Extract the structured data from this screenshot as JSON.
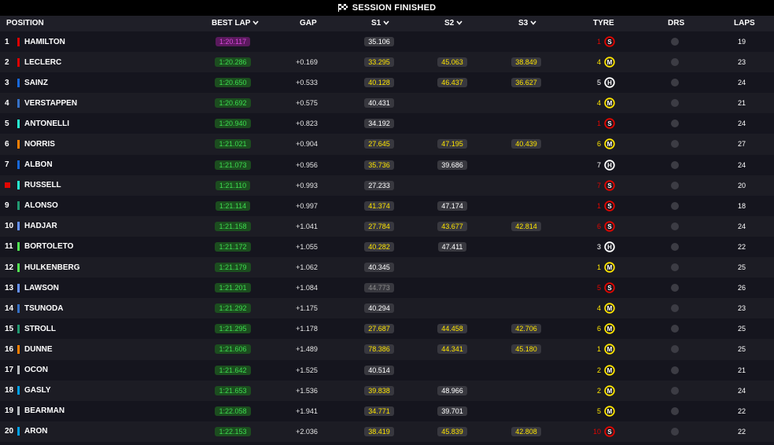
{
  "banner": {
    "title": "SESSION FINISHED"
  },
  "header": {
    "position": "POSITION",
    "best_lap": "BEST LAP",
    "gap": "GAP",
    "s1": "S1",
    "s2": "S2",
    "s3": "S3",
    "tyre": "TYRE",
    "drs": "DRS",
    "laps": "LAPS"
  },
  "colors": {
    "purple_time": "#d646d9",
    "green_time": "#3ddc4f",
    "yellow_sector": "#fce300",
    "soft": "#e10600",
    "medium": "#fce300",
    "hard": "#ffffff"
  },
  "rows": [
    {
      "pos": "1",
      "driver": "HAMILTON",
      "team_color": "#dc0000",
      "best": "1:20.117",
      "best_purple": true,
      "gap": "",
      "s1": "35.106",
      "s1c": "w",
      "s2": "",
      "s2c": "",
      "s3": "",
      "s3c": "",
      "tyre_age": "1",
      "tyre": "S",
      "laps": "19"
    },
    {
      "pos": "2",
      "driver": "LECLERC",
      "team_color": "#dc0000",
      "best": "1:20.286",
      "best_purple": false,
      "gap": "+0.169",
      "s1": "33.295",
      "s1c": "y",
      "s2": "45.063",
      "s2c": "y",
      "s3": "38.849",
      "s3c": "y",
      "tyre_age": "4",
      "tyre": "M",
      "laps": "23"
    },
    {
      "pos": "3",
      "driver": "SAINZ",
      "team_color": "#1868db",
      "best": "1:20.650",
      "best_purple": false,
      "gap": "+0.533",
      "s1": "40.128",
      "s1c": "y",
      "s2": "46.437",
      "s2c": "y",
      "s3": "36.627",
      "s3c": "y",
      "tyre_age": "5",
      "tyre": "H",
      "laps": "24"
    },
    {
      "pos": "4",
      "driver": "VERSTAPPEN",
      "team_color": "#3671c6",
      "best": "1:20.692",
      "best_purple": false,
      "gap": "+0.575",
      "s1": "40.431",
      "s1c": "w",
      "s2": "",
      "s2c": "",
      "s3": "",
      "s3c": "",
      "tyre_age": "4",
      "tyre": "M",
      "laps": "21"
    },
    {
      "pos": "5",
      "driver": "ANTONELLI",
      "team_color": "#27f4d2",
      "best": "1:20.940",
      "best_purple": false,
      "gap": "+0.823",
      "s1": "34.192",
      "s1c": "w",
      "s2": "",
      "s2c": "",
      "s3": "",
      "s3c": "",
      "tyre_age": "1",
      "tyre": "S",
      "laps": "24"
    },
    {
      "pos": "6",
      "driver": "NORRIS",
      "team_color": "#ff8000",
      "best": "1:21.021",
      "best_purple": false,
      "gap": "+0.904",
      "s1": "27.645",
      "s1c": "y",
      "s2": "47.195",
      "s2c": "y",
      "s3": "40.439",
      "s3c": "y",
      "tyre_age": "6",
      "tyre": "M",
      "laps": "27"
    },
    {
      "pos": "7",
      "driver": "ALBON",
      "team_color": "#1868db",
      "best": "1:21.073",
      "best_purple": false,
      "gap": "+0.956",
      "s1": "35.736",
      "s1c": "y",
      "s2": "39.686",
      "s2c": "w",
      "s3": "",
      "s3c": "",
      "tyre_age": "7",
      "tyre": "H",
      "laps": "24"
    },
    {
      "pos": "FLAG",
      "driver": "RUSSELL",
      "team_color": "#27f4d2",
      "best": "1:21.110",
      "best_purple": false,
      "gap": "+0.993",
      "s1": "27.233",
      "s1c": "w",
      "s2": "",
      "s2c": "",
      "s3": "",
      "s3c": "",
      "tyre_age": "7",
      "tyre": "S",
      "laps": "20"
    },
    {
      "pos": "9",
      "driver": "ALONSO",
      "team_color": "#229971",
      "best": "1:21.114",
      "best_purple": false,
      "gap": "+0.997",
      "s1": "41.374",
      "s1c": "y",
      "s2": "47.174",
      "s2c": "w",
      "s3": "",
      "s3c": "",
      "tyre_age": "1",
      "tyre": "S",
      "laps": "18"
    },
    {
      "pos": "10",
      "driver": "HADJAR",
      "team_color": "#6692ff",
      "best": "1:21.158",
      "best_purple": false,
      "gap": "+1.041",
      "s1": "27.784",
      "s1c": "y",
      "s2": "43.677",
      "s2c": "y",
      "s3": "42.814",
      "s3c": "y",
      "tyre_age": "6",
      "tyre": "S",
      "laps": "24"
    },
    {
      "pos": "11",
      "driver": "BORTOLETO",
      "team_color": "#52e252",
      "best": "1:21.172",
      "best_purple": false,
      "gap": "+1.055",
      "s1": "40.282",
      "s1c": "y",
      "s2": "47.411",
      "s2c": "w",
      "s3": "",
      "s3c": "",
      "tyre_age": "3",
      "tyre": "H",
      "laps": "22"
    },
    {
      "pos": "12",
      "driver": "HULKENBERG",
      "team_color": "#52e252",
      "best": "1:21.179",
      "best_purple": false,
      "gap": "+1.062",
      "s1": "40.345",
      "s1c": "w",
      "s2": "",
      "s2c": "",
      "s3": "",
      "s3c": "",
      "tyre_age": "1",
      "tyre": "M",
      "laps": "25"
    },
    {
      "pos": "13",
      "driver": "LAWSON",
      "team_color": "#6692ff",
      "best": "1:21.201",
      "best_purple": false,
      "gap": "+1.084",
      "s1": "44.773",
      "s1c": "g",
      "s2": "",
      "s2c": "",
      "s3": "",
      "s3c": "",
      "tyre_age": "5",
      "tyre": "S",
      "laps": "26"
    },
    {
      "pos": "14",
      "driver": "TSUNODA",
      "team_color": "#3671c6",
      "best": "1:21.292",
      "best_purple": false,
      "gap": "+1.175",
      "s1": "40.294",
      "s1c": "w",
      "s2": "",
      "s2c": "",
      "s3": "",
      "s3c": "",
      "tyre_age": "4",
      "tyre": "M",
      "laps": "23"
    },
    {
      "pos": "15",
      "driver": "STROLL",
      "team_color": "#229971",
      "best": "1:21.295",
      "best_purple": false,
      "gap": "+1.178",
      "s1": "27.687",
      "s1c": "y",
      "s2": "44.458",
      "s2c": "y",
      "s3": "42.706",
      "s3c": "y",
      "tyre_age": "6",
      "tyre": "M",
      "laps": "25"
    },
    {
      "pos": "16",
      "driver": "DUNNE",
      "team_color": "#ff8000",
      "best": "1:21.606",
      "best_purple": false,
      "gap": "+1.489",
      "s1": "78.386",
      "s1c": "y",
      "s2": "44.341",
      "s2c": "y",
      "s3": "45.180",
      "s3c": "y",
      "tyre_age": "1",
      "tyre": "M",
      "laps": "25"
    },
    {
      "pos": "17",
      "driver": "OCON",
      "team_color": "#b6babd",
      "best": "1:21.642",
      "best_purple": false,
      "gap": "+1.525",
      "s1": "40.514",
      "s1c": "w",
      "s2": "",
      "s2c": "",
      "s3": "",
      "s3c": "",
      "tyre_age": "2",
      "tyre": "M",
      "laps": "21"
    },
    {
      "pos": "18",
      "driver": "GASLY",
      "team_color": "#00a1e8",
      "best": "1:21.653",
      "best_purple": false,
      "gap": "+1.536",
      "s1": "39.838",
      "s1c": "y",
      "s2": "48.966",
      "s2c": "w",
      "s3": "",
      "s3c": "",
      "tyre_age": "2",
      "tyre": "M",
      "laps": "24"
    },
    {
      "pos": "19",
      "driver": "BEARMAN",
      "team_color": "#b6babd",
      "best": "1:22.058",
      "best_purple": false,
      "gap": "+1.941",
      "s1": "34.771",
      "s1c": "y",
      "s2": "39.701",
      "s2c": "w",
      "s3": "",
      "s3c": "",
      "tyre_age": "5",
      "tyre": "M",
      "laps": "22"
    },
    {
      "pos": "20",
      "driver": "ARON",
      "team_color": "#00a1e8",
      "best": "1:22.153",
      "best_purple": false,
      "gap": "+2.036",
      "s1": "38.419",
      "s1c": "y",
      "s2": "45.839",
      "s2c": "y",
      "s3": "42.808",
      "s3c": "y",
      "tyre_age": "10",
      "tyre": "S",
      "laps": "22"
    }
  ]
}
